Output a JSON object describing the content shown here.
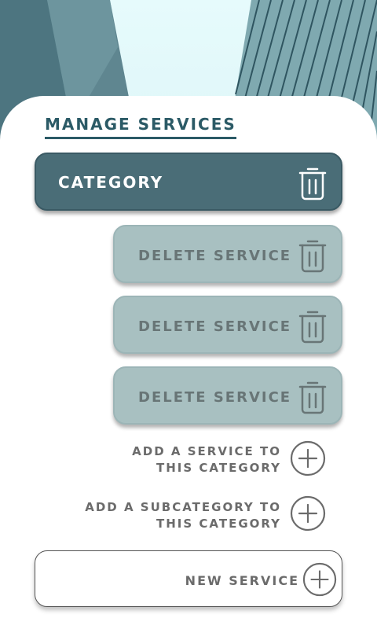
{
  "header": {
    "title": "MANAGE SERVICES",
    "image": "building-glass-facade"
  },
  "category": {
    "label": "CATEGORY",
    "icon": "trash-icon"
  },
  "services": [
    {
      "label": "DELETE SERVICE",
      "icon": "trash-icon"
    },
    {
      "label": "DELETE SERVICE",
      "icon": "trash-icon"
    },
    {
      "label": "DELETE SERVICE",
      "icon": "trash-icon"
    }
  ],
  "actions": {
    "add_service": {
      "line1": "ADD A SERVICE TO",
      "line2": "THIS CATEGORY",
      "icon": "plus-circle-icon"
    },
    "add_subcategory": {
      "line1": "ADD A SUBCATEGORY TO",
      "line2": "THIS CATEGORY",
      "icon": "plus-circle-icon"
    }
  },
  "new_service": {
    "label": "NEW SERVICE",
    "icon": "plus-circle-icon"
  },
  "colors": {
    "primary": "#4a6d77",
    "service_bg": "#a8c0c1",
    "title": "#2b5a66",
    "muted_text": "#6b6b6b"
  }
}
